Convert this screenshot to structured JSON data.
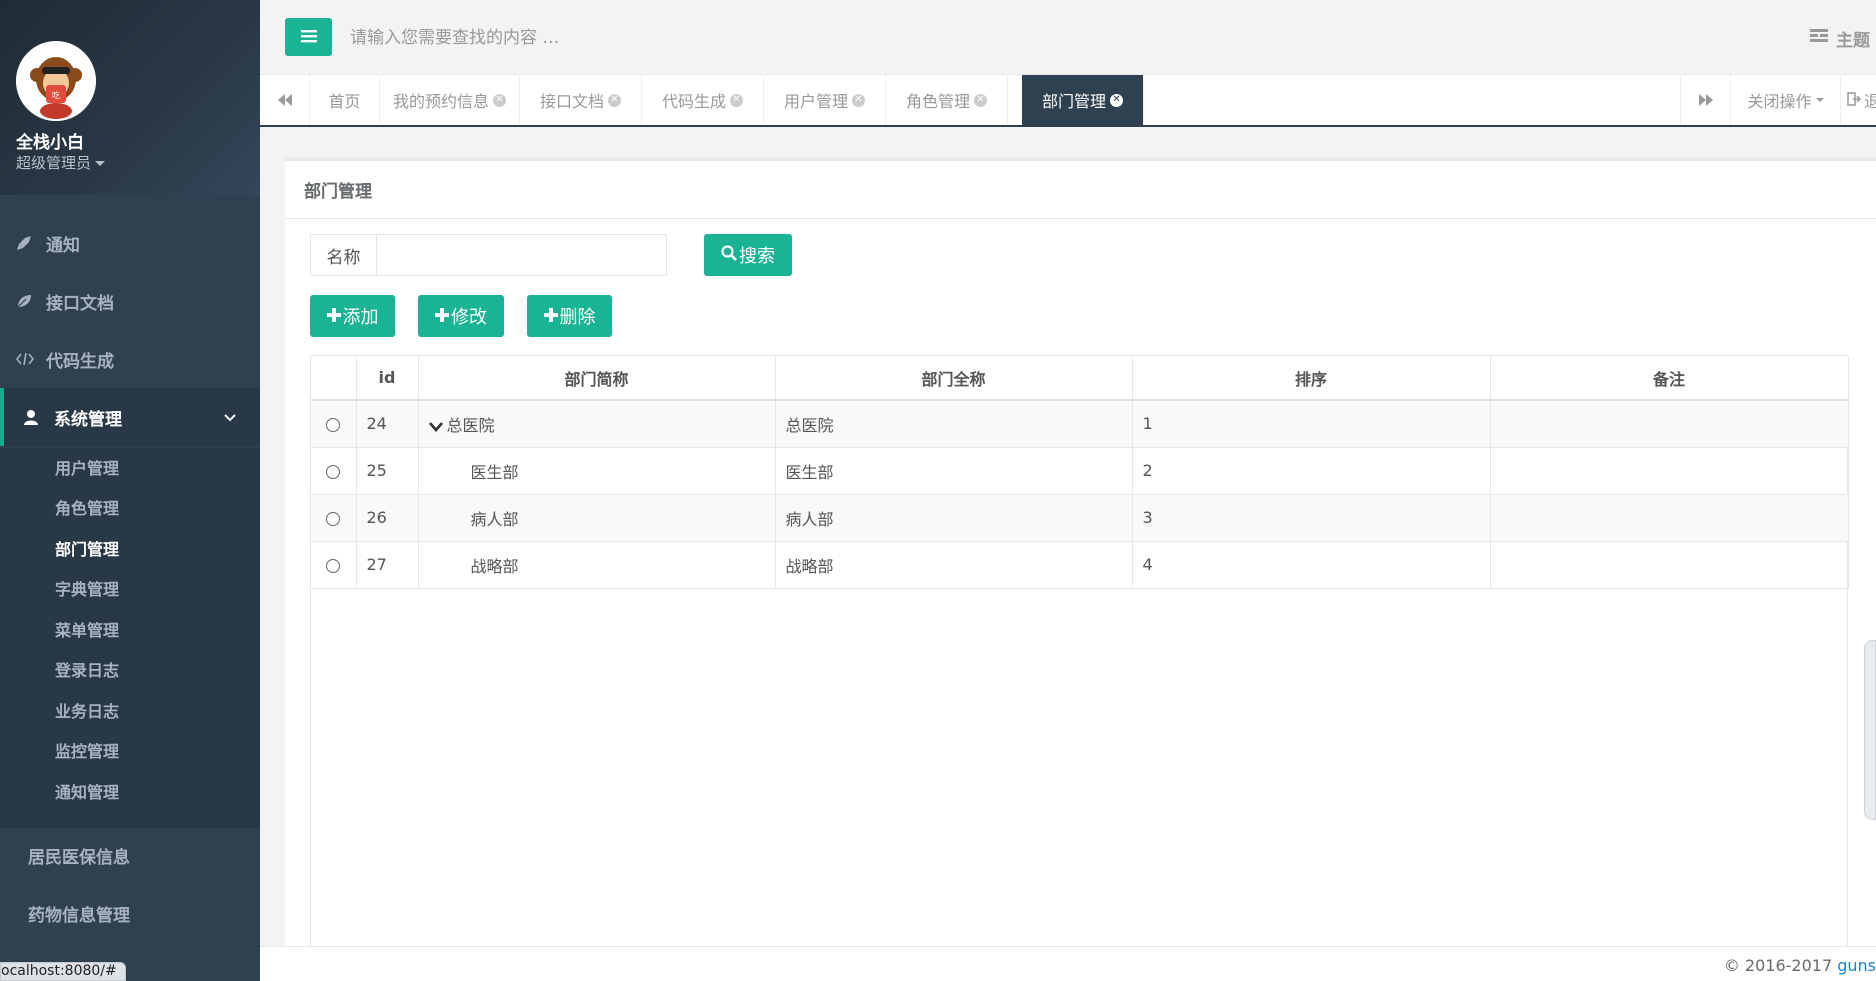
{
  "sidebar": {
    "profile": {
      "avatar_icon": "monkey-avatar-icon",
      "name": "全栈小白",
      "role": "超级管理员"
    },
    "nav": [
      {
        "label": "通知",
        "icon": "rocket-icon"
      },
      {
        "label": "接口文档",
        "icon": "leaf-icon"
      },
      {
        "label": "代码生成",
        "icon": "code-icon"
      },
      {
        "label": "系统管理",
        "icon": "user-icon"
      }
    ],
    "submenu": [
      "用户管理",
      "角色管理",
      "部门管理",
      "字典管理",
      "菜单管理",
      "登录日志",
      "业务日志",
      "监控管理",
      "通知管理"
    ],
    "extra_nav": [
      "居民医保信息",
      "药物信息管理"
    ],
    "colors": {
      "bg": "#2f4050",
      "active": "#293846",
      "accent": "#1ab394"
    }
  },
  "topbar": {
    "search_placeholder": "请输入您需要查找的内容 …",
    "theme_label": "主题"
  },
  "tabs": {
    "items": [
      {
        "label": "首页",
        "closable": false
      },
      {
        "label": "我的预约信息",
        "closable": true
      },
      {
        "label": "接口文档",
        "closable": true
      },
      {
        "label": "代码生成",
        "closable": true
      },
      {
        "label": "用户管理",
        "closable": true
      },
      {
        "label": "角色管理",
        "closable": true
      },
      {
        "label": "部门管理",
        "closable": true,
        "active": true
      }
    ],
    "close_ops_label": "关闭操作",
    "logout_label": "退"
  },
  "page": {
    "title": "部门管理",
    "filter_label": "名称",
    "filter_value": "",
    "search_button": "搜索",
    "add_button": "添加",
    "edit_button": "修改",
    "delete_button": "删除"
  },
  "table": {
    "headers": [
      "id",
      "部门简称",
      "部门全称",
      "排序",
      "备注"
    ],
    "rows": [
      {
        "id": "24",
        "short": "总医院",
        "full": "总医院",
        "order": "1",
        "note": ""
      },
      {
        "id": "25",
        "short": "医生部",
        "full": "医生部",
        "order": "2",
        "note": ""
      },
      {
        "id": "26",
        "short": "病人部",
        "full": "病人部",
        "order": "3",
        "note": ""
      },
      {
        "id": "27",
        "short": "战略部",
        "full": "战略部",
        "order": "4",
        "note": ""
      }
    ]
  },
  "footer": {
    "copyright": "© 2016-2017 ",
    "link": "guns"
  },
  "status_url": "ocalhost:8080/#"
}
